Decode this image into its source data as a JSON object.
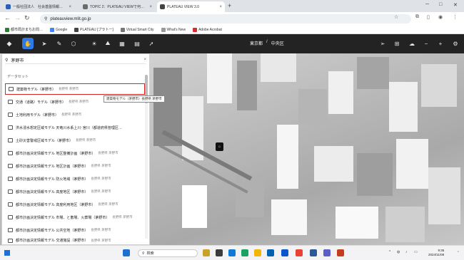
{
  "browser": {
    "tabs": [
      {
        "label": "一般社団法人　社会基盤情報…",
        "color": "#2b5fb5"
      },
      {
        "label": "TOPIC 2：PLATEAU VIEWで何…",
        "color": "#6b6b6b"
      },
      {
        "label": "PLATEAU VIEW 3.0",
        "color": "#444"
      }
    ],
    "url": "plateauview.mlit.go.jp",
    "bookmarks": [
      {
        "label": "都市局計まちお問…",
        "color": "#2e7d32"
      },
      {
        "label": "Google",
        "color": "#4285f4"
      },
      {
        "label": "PLATEAU [プラトー]",
        "color": "#444"
      },
      {
        "label": "Virtual Smart City",
        "color": "#777"
      },
      {
        "label": "What's New",
        "color": "#999"
      },
      {
        "label": "Adobe Acrobat",
        "color": "#d32f2f"
      }
    ]
  },
  "app": {
    "breadcrumb": [
      "東京都",
      "中央区"
    ]
  },
  "panel": {
    "search_value": "茅野市",
    "section_label": "データセット",
    "tooltip": "建築物モデル（茅野市）長野県 茅野市",
    "items": [
      {
        "label": "建築物モデル（茅野市）",
        "sub": "長野県 茅野市",
        "selected": true
      },
      {
        "label": "交通（道路）モデル（茅野市）",
        "sub": "長野県 茅野市"
      },
      {
        "label": "土地利用モデル（茅野市）",
        "sub": "長野県 茅野市"
      },
      {
        "label": "洪水浸水想定区域モデル 天竜川水系上川･宮川（都道府県管理区…",
        "sub": ""
      },
      {
        "label": "土砂災害警戒区域モデル（茅野市）",
        "sub": "長野県 茅野市"
      },
      {
        "label": "都市計画決定情報モデル 地区整備計画（茅野市）",
        "sub": "長野県 茅野市"
      },
      {
        "label": "都市計画決定情報モデル 地区計画（茅野市）",
        "sub": "長野県 茅野市"
      },
      {
        "label": "都市計画決定情報モデル 防火地域（茅野市）",
        "sub": "長野県 茅野市"
      },
      {
        "label": "都市計画決定情報モデル 高度地区（茅野市）",
        "sub": "長野県 茅野市"
      },
      {
        "label": "都市計画決定情報モデル 高度利用地区（茅野市）",
        "sub": "長野県 茅野市"
      },
      {
        "label": "都市計画決定情報モデル 市場、と畜場、火葬場（茅野市）",
        "sub": "長野県 茅野市"
      },
      {
        "label": "都市計画決定情報モデル 公共空地（茅野市）",
        "sub": "長野県 茅野市"
      },
      {
        "label": "都市計画決定情報モデル 交通施設（茅野市）",
        "sub": "長野県 茅野市"
      }
    ]
  },
  "taskbar": {
    "search_placeholder": "検索",
    "time": "9:35",
    "date": "2024/11/08"
  }
}
